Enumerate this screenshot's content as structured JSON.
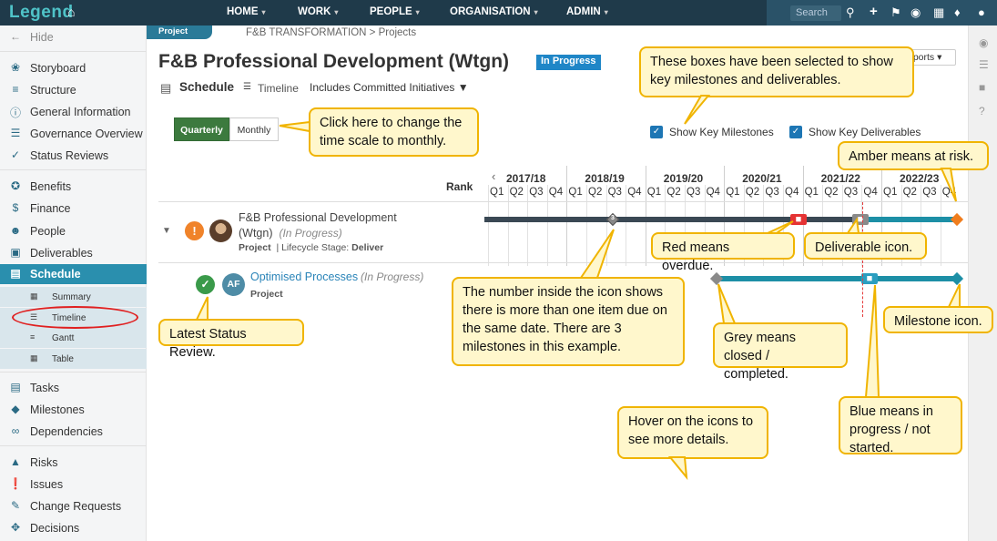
{
  "nav": {
    "logo": "Legend",
    "menu": [
      "HOME",
      "WORK",
      "PEOPLE",
      "ORGANISATION",
      "ADMIN"
    ],
    "search_placeholder": "Search"
  },
  "sidebar": {
    "hide": "Hide",
    "items": [
      "Storyboard",
      "Structure",
      "General Information",
      "Governance Overview",
      "Status Reviews",
      "Benefits",
      "Finance",
      "People",
      "Deliverables",
      "Schedule"
    ],
    "schedule_sub": [
      "Summary",
      "Timeline",
      "Gantt",
      "Table"
    ],
    "items2": [
      "Tasks",
      "Milestones",
      "Dependencies",
      "Risks",
      "Issues",
      "Change Requests",
      "Decisions"
    ]
  },
  "header": {
    "project_tab": "Project",
    "breadcrumb": "F&B TRANSFORMATION > Projects",
    "title": "F&B Professional Development (Wtgn)",
    "status": "In Progress",
    "reports": "eports"
  },
  "schedule": {
    "label": "Schedule",
    "view": "Timeline",
    "includes": "Includes Committed Initiatives",
    "btn_quarterly": "Quarterly",
    "btn_monthly": "Monthly",
    "show_milestones": "Show Key Milestones",
    "show_deliverables": "Show Key Deliverables"
  },
  "gantt": {
    "rank_label": "Rank",
    "years": [
      "2017/18",
      "2018/19",
      "2019/20",
      "2020/21",
      "2021/22",
      "2022/23"
    ],
    "quarters": [
      "Q1",
      "Q2",
      "Q3",
      "Q4"
    ],
    "milestone_count": "3",
    "rows": [
      {
        "name": "F&B Professional Development",
        "name2": "(Wtgn)",
        "status": "(In Progress)",
        "type": "Project",
        "stage_label": "Lifecycle Stage:",
        "stage": "Deliver"
      },
      {
        "name": "Optimised Processes",
        "status": "(In Progress)",
        "type": "Project",
        "initials": "AF"
      }
    ]
  },
  "callouts": {
    "boxes_selected": "These boxes have been selected to show key milestones and deliverables.",
    "time_scale": "Click here to change the time scale to monthly.",
    "amber": "Amber means at risk.",
    "red": "Red means overdue.",
    "deliverable": "Deliverable icon.",
    "number_inside": "The number inside the icon shows there is more than one item due on the same date.  There are 3 milestones in this example.",
    "grey": "Grey means closed / completed.",
    "milestone": "Milestone icon.",
    "latest_status": "Latest Status Review.",
    "blue": "Blue means in progress / not started.",
    "hover": "Hover on the icons to see more details."
  },
  "colors": {
    "nav_bg": "#1f3a4a",
    "accent": "#2a8fae",
    "bar_dark": "#3a4854",
    "bar_blue": "#1d8fa6",
    "overdue_red": "#e53333",
    "at_risk_amber": "#f07d1d",
    "closed_grey": "#8a8a8a",
    "callout_fill": "#fff7cc",
    "callout_border": "#f0b400"
  }
}
